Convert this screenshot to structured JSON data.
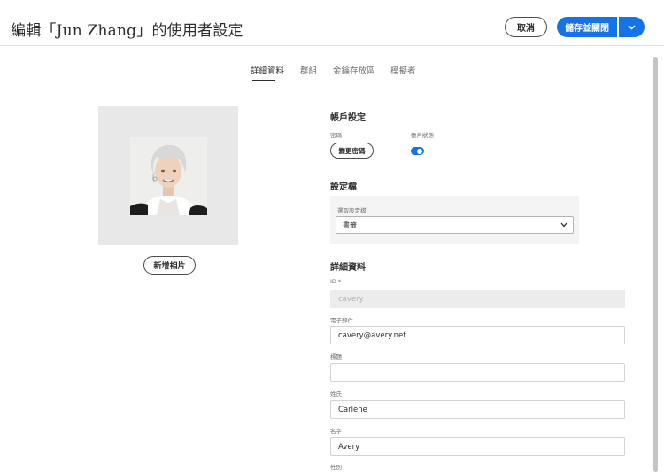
{
  "header": {
    "title": "編輯「Jun Zhang」的使用者設定",
    "cancel_label": "取消",
    "save_label": "儲存並關閉",
    "save_menu_icon": "chevron-down-icon",
    "accent_color": "#1473e6"
  },
  "tabs": [
    {
      "label": "詳細資料",
      "active": true
    },
    {
      "label": "群組",
      "active": false
    },
    {
      "label": "金鑰存放區",
      "active": false
    },
    {
      "label": "模擬者",
      "active": false
    }
  ],
  "photo": {
    "add_photo_label": "新增相片"
  },
  "account": {
    "title": "帳戶設定",
    "password_label": "密碼",
    "change_password_label": "變更密碼",
    "status_label": "帳戶狀態",
    "status_enabled": true
  },
  "profile": {
    "title": "設定檔",
    "select_label": "選取設定檔",
    "selected": "書籤"
  },
  "details": {
    "title": "詳細資料",
    "fields": [
      {
        "label": "ID *",
        "value": "cavery",
        "disabled": true
      },
      {
        "label": "電子郵件",
        "value": "cavery@avery.net",
        "disabled": false
      },
      {
        "label": "標題",
        "value": "",
        "disabled": false
      },
      {
        "label": "姓氏",
        "value": "Carlene",
        "disabled": false
      },
      {
        "label": "名字",
        "value": "Avery",
        "disabled": false
      },
      {
        "label": "性別",
        "value": "",
        "disabled": false
      }
    ]
  }
}
